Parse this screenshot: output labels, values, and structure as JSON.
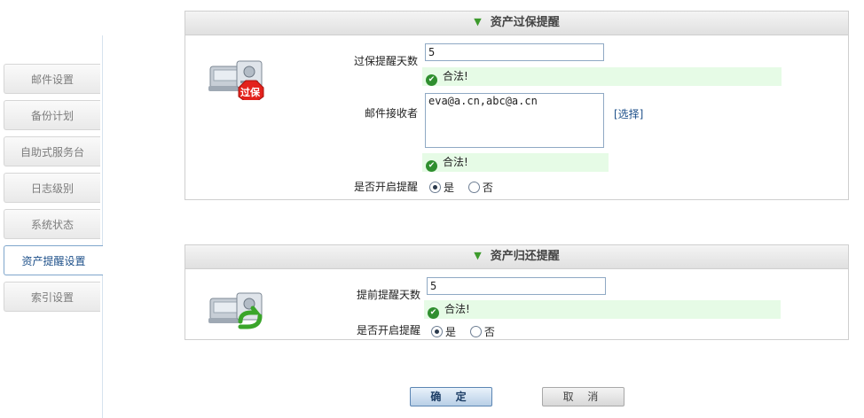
{
  "sidebar": {
    "items": [
      {
        "label": "邮件设置"
      },
      {
        "label": "备份计划"
      },
      {
        "label": "自助式服务台"
      },
      {
        "label": "日志级别"
      },
      {
        "label": "系统状态"
      },
      {
        "label": "资产提醒设置",
        "active": true
      },
      {
        "label": "索引设置"
      }
    ]
  },
  "warranty_panel": {
    "title": "资产过保提醒",
    "icon_badge": "过保",
    "days_label": "过保提醒天数",
    "days_value": "5",
    "days_status": "合法!",
    "recipients_label": "邮件接收者",
    "recipients_value": "eva@a.cn,abc@a.cn",
    "select_link": "[选择]",
    "recipients_status": "合法!",
    "enable_label": "是否开启提醒",
    "yes_label": "是",
    "no_label": "否",
    "enabled": true
  },
  "return_panel": {
    "title": "资产归还提醒",
    "days_label": "提前提醒天数",
    "days_value": "5",
    "days_status": "合法!",
    "enable_label": "是否开启提醒",
    "yes_label": "是",
    "no_label": "否",
    "enabled": true
  },
  "actions": {
    "confirm_label": "确 定",
    "cancel_label": "取 消"
  },
  "colors": {
    "valid_background": "#e6fbe6",
    "valid_icon": "#2f8f2f",
    "accent": "#1c4f89"
  }
}
